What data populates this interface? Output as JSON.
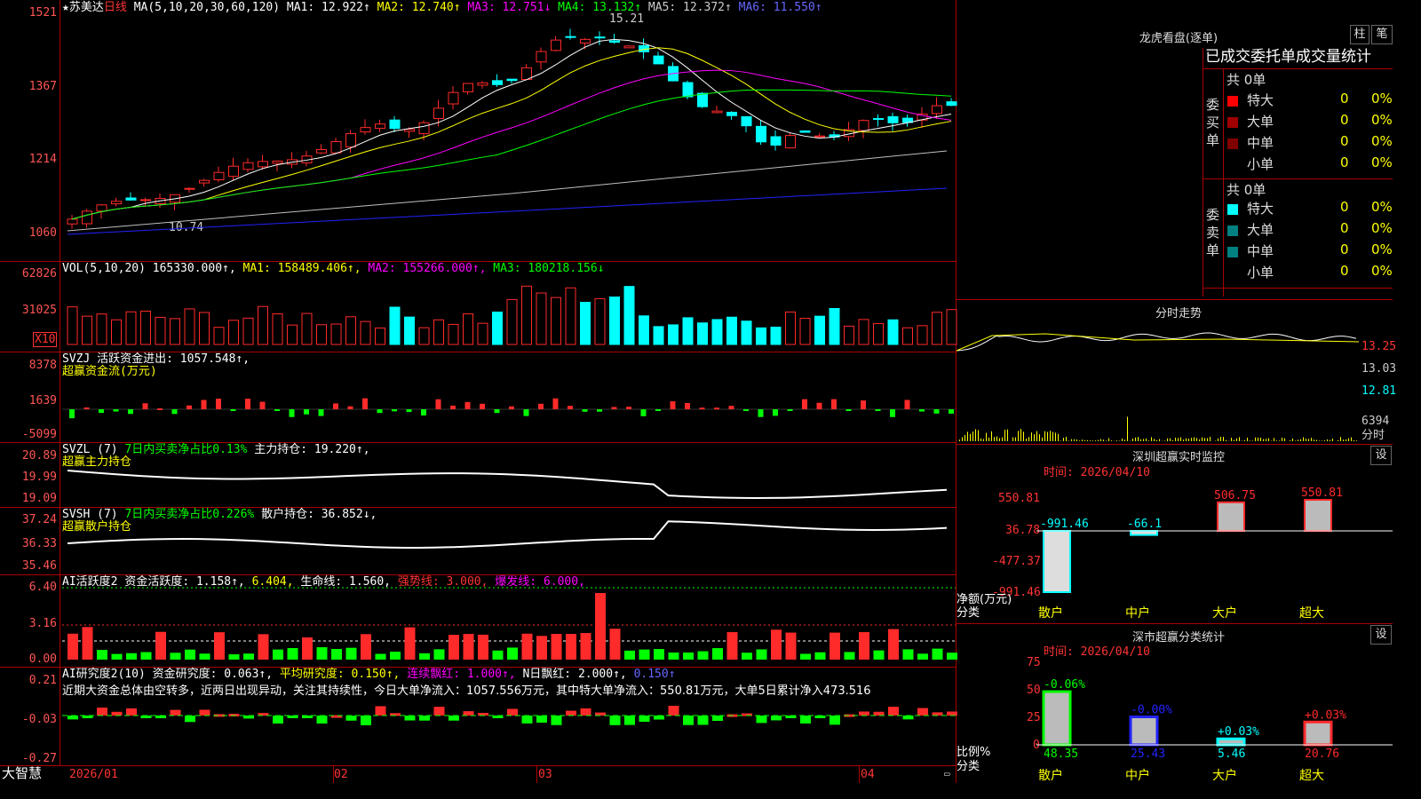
{
  "colors": {
    "up": "#ff2a2a",
    "down": "#00ffff",
    "ma1": "#ffffff",
    "ma2": "#ffff00",
    "ma3": "#ff00ff",
    "ma4": "#00ff00",
    "ma5": "#c0c0c0",
    "ma6": "#2222ff",
    "grid": "#a00000"
  },
  "title": {
    "name": "苏美达",
    "period": "日线",
    "ma_params": "MA(5,10,20,30,60,120)",
    "ma1": "MA1: 12.922↑",
    "ma2": "MA2: 12.740↑",
    "ma3": "MA3: 12.751↓",
    "ma4": "MA4: 13.132↑",
    "ma5": "MA5: 12.372↑",
    "ma6": "MA6: 11.550↑",
    "high_mark": "15.21",
    "low_mark": "10.74"
  },
  "price_axis": [
    "1521",
    "1367",
    "1214",
    "1060"
  ],
  "vol": {
    "header": "VOL(5,10,20)",
    "value": "165330.000↑,",
    "ma1": "MA1: 158489.406↑,",
    "ma2": "MA2: 155266.000↑,",
    "ma3": "MA3: 180218.156↓",
    "axis": [
      "62826",
      "31025"
    ],
    "unit": "X10"
  },
  "svzj": {
    "header": "SVZJ  活跃资金进出: 1057.548↑,",
    "sub": "超赢资金流(万元)",
    "axis": [
      "8378",
      "1639",
      "-5099"
    ]
  },
  "svzl": {
    "header": "SVZL (7)",
    "h2": "7日内买卖净占比0.13%",
    "h3": "主力持仓: 19.220↑,",
    "sub": "超赢主力持仓",
    "axis": [
      "20.89",
      "19.99",
      "19.09"
    ]
  },
  "svsh": {
    "header": "SVSH (7)",
    "h2": "7日内买卖净占比0.226%",
    "h3": "散户持仓: 36.852↓,",
    "sub": "超赢散户持仓",
    "axis": [
      "37.24",
      "36.33",
      "35.46"
    ]
  },
  "ai1": {
    "header": "AI活跃度2",
    "a": "资金活跃度: 1.158↑,",
    "b": "6.404,",
    "c": "生命线: 1.560,",
    "d": "强势线: 3.000,",
    "e": "爆发线: 6.000,",
    "axis": [
      "6.40",
      "3.16",
      "0.00"
    ]
  },
  "ai2": {
    "header": "AI研究度2(10)",
    "a": "资金研究度: 0.063↑,",
    "b": "平均研究度: 0.150↑,",
    "c": "连续飘红: 1.000↑,",
    "d": "N日飘红: 2.000↑,",
    "e": "0.150↑",
    "text": "近期大资金总体由空转多，近两日出现异动，关注其持续性，今日大单净流入：1057.556万元，其中特大单净流入：550.81万元，大单5日累计净入473.516",
    "axis": [
      "0.21",
      "-0.03",
      "-0.27"
    ]
  },
  "xaxis": {
    "brand": "大智慧",
    "labels": [
      "2026/01",
      "02",
      "03",
      "04"
    ]
  },
  "lhb": {
    "title": "龙虎看盘(逐单)",
    "btn1": "柱",
    "btn2": "笔",
    "tabs": "已成交委托单成交量统计",
    "buy": {
      "label": "委买单",
      "total": "共 0单",
      "rows": [
        {
          "name": "特大",
          "val": "0",
          "pct": "0%"
        },
        {
          "name": "大单",
          "val": "0",
          "pct": "0%"
        },
        {
          "name": "中单",
          "val": "0",
          "pct": "0%"
        },
        {
          "name": "小单",
          "val": "0",
          "pct": "0%"
        }
      ]
    },
    "sell": {
      "label": "委卖单",
      "total": "共 0单",
      "rows": [
        {
          "name": "特大",
          "val": "0",
          "pct": "0%"
        },
        {
          "name": "大单",
          "val": "0",
          "pct": "0%"
        },
        {
          "name": "中单",
          "val": "0",
          "pct": "0%"
        },
        {
          "name": "小单",
          "val": "0",
          "pct": "0%"
        }
      ]
    }
  },
  "intraday": {
    "title": "分时走势",
    "axis": [
      "13.25",
      "13.03",
      "12.81"
    ],
    "vol_axis": "6394",
    "vol_unit": "分时"
  },
  "monitor": {
    "title": "深圳超赢实时监控",
    "btn": "设",
    "time": "时间: 2026/04/10",
    "axis": [
      "550.81",
      "36.78",
      "-477.37",
      "-991.46"
    ],
    "ylabel": "净额(万元)",
    "xlabel": "分类"
  },
  "stats": {
    "title": "深市超赢分类统计",
    "btn": "设",
    "time": "时间: 2026/04/10",
    "axis": [
      "75",
      "50",
      "25",
      "0"
    ],
    "ylabel": "比例%",
    "xlabel": "分类"
  },
  "chart_data": [
    {
      "type": "bar",
      "title": "深圳超赢实时监控",
      "categories": [
        "散户",
        "中户",
        "大户",
        "超大"
      ],
      "values": [
        -991.46,
        -66.1,
        506.75,
        550.81
      ],
      "ylim": [
        -991.46,
        550.81
      ]
    },
    {
      "type": "bar",
      "title": "深市超赢分类统计",
      "categories": [
        "散户",
        "中户",
        "大户",
        "超大"
      ],
      "values": [
        48.35,
        25.43,
        5.46,
        20.76
      ],
      "changes": [
        "-0.06%",
        "-0.00%",
        "+0.03%",
        "+0.03%"
      ],
      "ylim": [
        0,
        75
      ]
    }
  ]
}
